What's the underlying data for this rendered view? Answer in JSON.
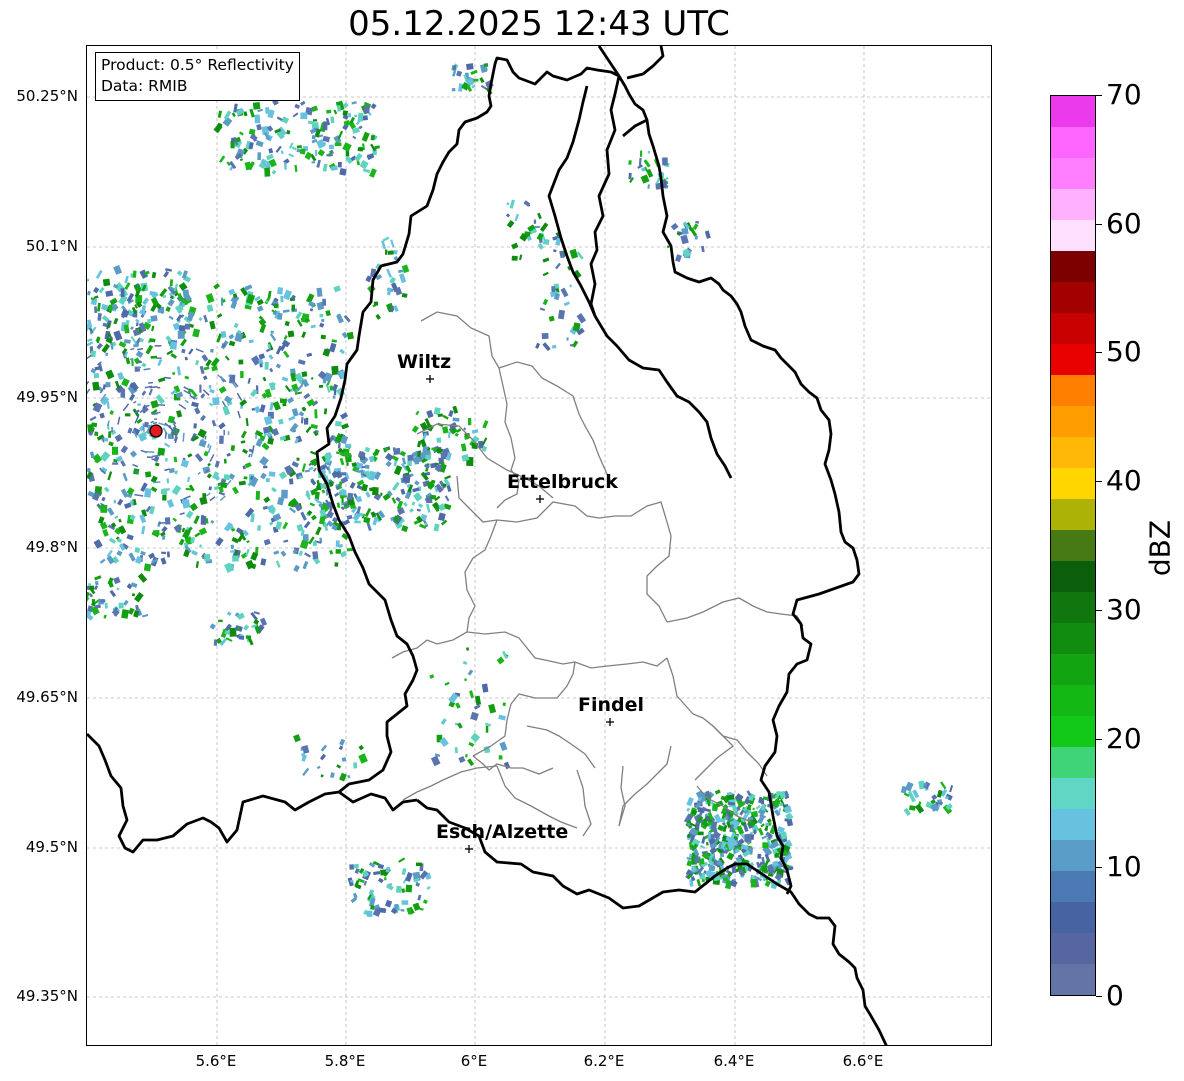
{
  "title": "05.12.2025 12:43 UTC",
  "info_box": {
    "product": "Product: 0.5° Reflectivity",
    "data": "Data: RMIB"
  },
  "lat_labels": [
    "50.25°N",
    "50.1°N",
    "49.95°N",
    "49.8°N",
    "49.65°N",
    "49.5°N",
    "49.35°N"
  ],
  "lon_labels": [
    "5.6°E",
    "5.8°E",
    "6°E",
    "6.2°E",
    "6.4°E",
    "6.6°E"
  ],
  "cities": [
    "Wiltz",
    "Ettelbruck",
    "Findel",
    "Esch/Alzette"
  ],
  "radar_site_icon": "red-dot-icon",
  "colorbar": {
    "unit": "dBZ",
    "ticks": [
      "0",
      "10",
      "20",
      "30",
      "40",
      "50",
      "60",
      "70"
    ],
    "range": [
      0,
      70
    ],
    "colors": [
      "#6474a7",
      "#5566a0",
      "#4863a2",
      "#4a79b3",
      "#5a9cc8",
      "#66c2df",
      "#60d6c4",
      "#40d478",
      "#12c818",
      "#14b814",
      "#13a511",
      "#128c10",
      "#0f770e",
      "#0b5f0a",
      "#467a12",
      "#adb306",
      "#ffd600",
      "#ffb807",
      "#ff9d00",
      "#ff7f00",
      "#e80000",
      "#c80000",
      "#a30000",
      "#7d0000",
      "#ffe1ff",
      "#ffb0ff",
      "#ff7fff",
      "#ff65ff",
      "#ea3aec"
    ]
  }
}
